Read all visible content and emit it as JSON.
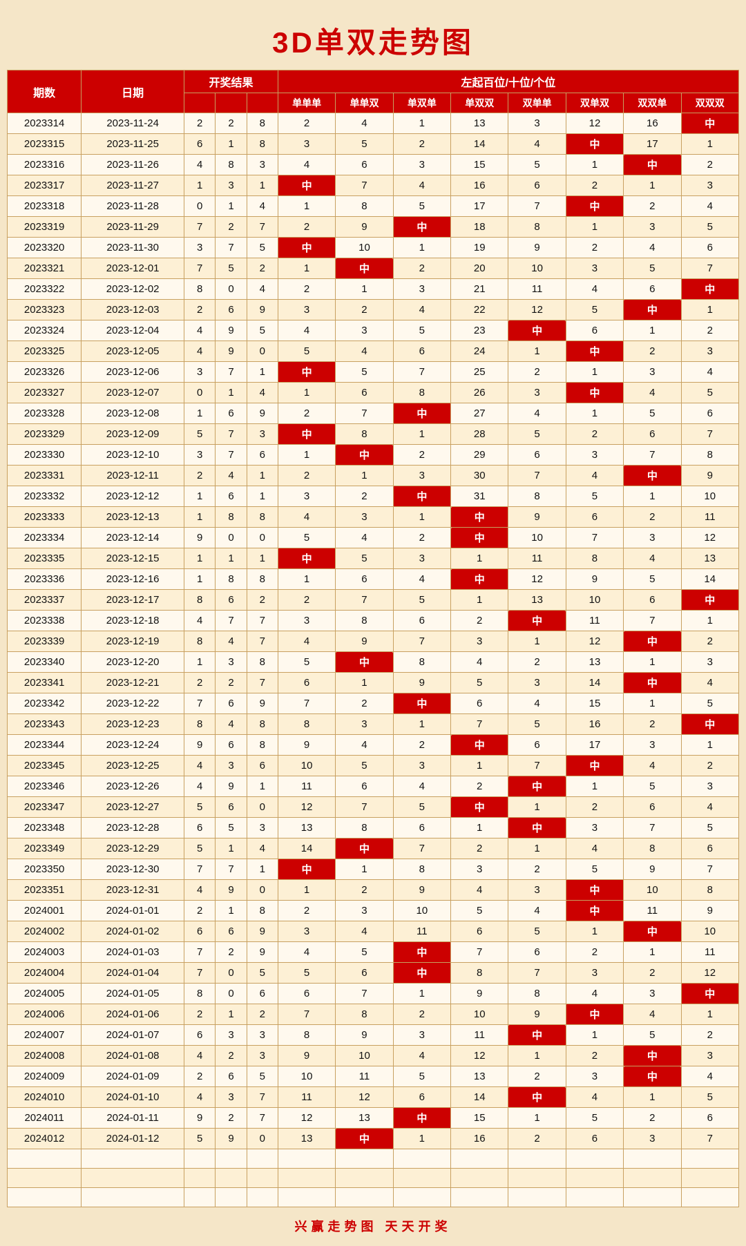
{
  "title": "3D单双走势图",
  "subtitle": "左起百位/十位/个位",
  "headers": {
    "qishu": "期数",
    "riqi": "日期",
    "kaijang": "开奖结果",
    "cols": [
      "单单单",
      "单单双",
      "单双单",
      "单双双",
      "双单单",
      "双单双",
      "双双单",
      "双双双"
    ]
  },
  "footer": "兴赢走势图   天天开奖",
  "rows": [
    {
      "id": "2023314",
      "date": "2023-11-24",
      "k1": "2",
      "k2": "2",
      "k3": "8",
      "d": [
        2,
        4,
        1,
        13,
        3,
        12,
        16,
        "中"
      ]
    },
    {
      "id": "2023315",
      "date": "2023-11-25",
      "k1": "6",
      "k2": "1",
      "k3": "8",
      "d": [
        3,
        5,
        2,
        14,
        4,
        "中",
        17,
        1
      ]
    },
    {
      "id": "2023316",
      "date": "2023-11-26",
      "k1": "4",
      "k2": "8",
      "k3": "3",
      "d": [
        4,
        6,
        3,
        15,
        5,
        1,
        "中",
        2
      ]
    },
    {
      "id": "2023317",
      "date": "2023-11-27",
      "k1": "1",
      "k2": "3",
      "k3": "1",
      "d": [
        "中",
        7,
        4,
        16,
        6,
        2,
        1,
        3
      ]
    },
    {
      "id": "2023318",
      "date": "2023-11-28",
      "k1": "0",
      "k2": "1",
      "k3": "4",
      "d": [
        1,
        8,
        5,
        17,
        7,
        "中",
        2,
        4
      ]
    },
    {
      "id": "2023319",
      "date": "2023-11-29",
      "k1": "7",
      "k2": "2",
      "k3": "7",
      "d": [
        2,
        9,
        "中",
        18,
        8,
        1,
        3,
        5
      ]
    },
    {
      "id": "2023320",
      "date": "2023-11-30",
      "k1": "3",
      "k2": "7",
      "k3": "5",
      "d": [
        "中",
        10,
        1,
        19,
        9,
        2,
        4,
        6
      ]
    },
    {
      "id": "2023321",
      "date": "2023-12-01",
      "k1": "7",
      "k2": "5",
      "k3": "2",
      "d": [
        1,
        "中",
        2,
        20,
        10,
        3,
        5,
        7
      ]
    },
    {
      "id": "2023322",
      "date": "2023-12-02",
      "k1": "8",
      "k2": "0",
      "k3": "4",
      "d": [
        2,
        1,
        3,
        21,
        11,
        4,
        6,
        "中"
      ]
    },
    {
      "id": "2023323",
      "date": "2023-12-03",
      "k1": "2",
      "k2": "6",
      "k3": "9",
      "d": [
        3,
        2,
        4,
        22,
        12,
        5,
        "中",
        1
      ]
    },
    {
      "id": "2023324",
      "date": "2023-12-04",
      "k1": "4",
      "k2": "9",
      "k3": "5",
      "d": [
        4,
        3,
        5,
        23,
        "中",
        6,
        1,
        2
      ]
    },
    {
      "id": "2023325",
      "date": "2023-12-05",
      "k1": "4",
      "k2": "9",
      "k3": "0",
      "d": [
        5,
        4,
        6,
        24,
        1,
        "中",
        2,
        3
      ]
    },
    {
      "id": "2023326",
      "date": "2023-12-06",
      "k1": "3",
      "k2": "7",
      "k3": "1",
      "d": [
        "中",
        5,
        7,
        25,
        2,
        1,
        3,
        4
      ]
    },
    {
      "id": "2023327",
      "date": "2023-12-07",
      "k1": "0",
      "k2": "1",
      "k3": "4",
      "d": [
        1,
        6,
        8,
        26,
        3,
        "中",
        4,
        5
      ]
    },
    {
      "id": "2023328",
      "date": "2023-12-08",
      "k1": "1",
      "k2": "6",
      "k3": "9",
      "d": [
        2,
        7,
        "中",
        27,
        4,
        1,
        5,
        6
      ]
    },
    {
      "id": "2023329",
      "date": "2023-12-09",
      "k1": "5",
      "k2": "7",
      "k3": "3",
      "d": [
        "中",
        8,
        1,
        28,
        5,
        2,
        6,
        7
      ]
    },
    {
      "id": "2023330",
      "date": "2023-12-10",
      "k1": "3",
      "k2": "7",
      "k3": "6",
      "d": [
        1,
        "中",
        2,
        29,
        6,
        3,
        7,
        8
      ]
    },
    {
      "id": "2023331",
      "date": "2023-12-11",
      "k1": "2",
      "k2": "4",
      "k3": "1",
      "d": [
        2,
        1,
        3,
        30,
        7,
        4,
        "中",
        9
      ]
    },
    {
      "id": "2023332",
      "date": "2023-12-12",
      "k1": "1",
      "k2": "6",
      "k3": "1",
      "d": [
        3,
        2,
        "中",
        31,
        8,
        5,
        1,
        10
      ]
    },
    {
      "id": "2023333",
      "date": "2023-12-13",
      "k1": "1",
      "k2": "8",
      "k3": "8",
      "d": [
        4,
        3,
        1,
        "中",
        9,
        6,
        2,
        11
      ]
    },
    {
      "id": "2023334",
      "date": "2023-12-14",
      "k1": "9",
      "k2": "0",
      "k3": "0",
      "d": [
        5,
        4,
        2,
        "中",
        10,
        7,
        3,
        12
      ]
    },
    {
      "id": "2023335",
      "date": "2023-12-15",
      "k1": "1",
      "k2": "1",
      "k3": "1",
      "d": [
        "中",
        5,
        3,
        1,
        11,
        8,
        4,
        13
      ]
    },
    {
      "id": "2023336",
      "date": "2023-12-16",
      "k1": "1",
      "k2": "8",
      "k3": "8",
      "d": [
        1,
        6,
        4,
        "中",
        12,
        9,
        5,
        14
      ]
    },
    {
      "id": "2023337",
      "date": "2023-12-17",
      "k1": "8",
      "k2": "6",
      "k3": "2",
      "d": [
        2,
        7,
        5,
        1,
        13,
        10,
        6,
        "中"
      ]
    },
    {
      "id": "2023338",
      "date": "2023-12-18",
      "k1": "4",
      "k2": "7",
      "k3": "7",
      "d": [
        3,
        8,
        6,
        2,
        "中",
        11,
        7,
        1
      ]
    },
    {
      "id": "2023339",
      "date": "2023-12-19",
      "k1": "8",
      "k2": "4",
      "k3": "7",
      "d": [
        4,
        9,
        7,
        3,
        1,
        12,
        "中",
        2
      ]
    },
    {
      "id": "2023340",
      "date": "2023-12-20",
      "k1": "1",
      "k2": "3",
      "k3": "8",
      "d": [
        5,
        "中",
        8,
        4,
        2,
        13,
        1,
        3
      ]
    },
    {
      "id": "2023341",
      "date": "2023-12-21",
      "k1": "2",
      "k2": "2",
      "k3": "7",
      "d": [
        6,
        1,
        9,
        5,
        3,
        14,
        "中",
        4
      ]
    },
    {
      "id": "2023342",
      "date": "2023-12-22",
      "k1": "7",
      "k2": "6",
      "k3": "9",
      "d": [
        7,
        2,
        "中",
        6,
        4,
        15,
        1,
        5
      ]
    },
    {
      "id": "2023343",
      "date": "2023-12-23",
      "k1": "8",
      "k2": "4",
      "k3": "8",
      "d": [
        8,
        3,
        1,
        7,
        5,
        16,
        2,
        "中"
      ]
    },
    {
      "id": "2023344",
      "date": "2023-12-24",
      "k1": "9",
      "k2": "6",
      "k3": "8",
      "d": [
        9,
        4,
        2,
        "中",
        6,
        17,
        3,
        1
      ]
    },
    {
      "id": "2023345",
      "date": "2023-12-25",
      "k1": "4",
      "k2": "3",
      "k3": "6",
      "d": [
        10,
        5,
        3,
        1,
        7,
        "中",
        4,
        2
      ]
    },
    {
      "id": "2023346",
      "date": "2023-12-26",
      "k1": "4",
      "k2": "9",
      "k3": "1",
      "d": [
        11,
        6,
        4,
        2,
        "中",
        1,
        5,
        3
      ]
    },
    {
      "id": "2023347",
      "date": "2023-12-27",
      "k1": "5",
      "k2": "6",
      "k3": "0",
      "d": [
        12,
        7,
        5,
        "中",
        1,
        2,
        6,
        4
      ]
    },
    {
      "id": "2023348",
      "date": "2023-12-28",
      "k1": "6",
      "k2": "5",
      "k3": "3",
      "d": [
        13,
        8,
        6,
        1,
        "中",
        3,
        7,
        5
      ]
    },
    {
      "id": "2023349",
      "date": "2023-12-29",
      "k1": "5",
      "k2": "1",
      "k3": "4",
      "d": [
        14,
        "中",
        7,
        2,
        1,
        4,
        8,
        6
      ]
    },
    {
      "id": "2023350",
      "date": "2023-12-30",
      "k1": "7",
      "k2": "7",
      "k3": "1",
      "d": [
        "中",
        1,
        8,
        3,
        2,
        5,
        9,
        7
      ]
    },
    {
      "id": "2023351",
      "date": "2023-12-31",
      "k1": "4",
      "k2": "9",
      "k3": "0",
      "d": [
        1,
        2,
        9,
        4,
        3,
        "中",
        10,
        8
      ]
    },
    {
      "id": "2024001",
      "date": "2024-01-01",
      "k1": "2",
      "k2": "1",
      "k3": "8",
      "d": [
        2,
        3,
        10,
        5,
        4,
        "中",
        11,
        9
      ]
    },
    {
      "id": "2024002",
      "date": "2024-01-02",
      "k1": "6",
      "k2": "6",
      "k3": "9",
      "d": [
        3,
        4,
        11,
        6,
        5,
        1,
        "中",
        10
      ]
    },
    {
      "id": "2024003",
      "date": "2024-01-03",
      "k1": "7",
      "k2": "2",
      "k3": "9",
      "d": [
        4,
        5,
        "中",
        7,
        6,
        2,
        1,
        11
      ]
    },
    {
      "id": "2024004",
      "date": "2024-01-04",
      "k1": "7",
      "k2": "0",
      "k3": "5",
      "d": [
        5,
        6,
        "中",
        8,
        7,
        3,
        2,
        12
      ]
    },
    {
      "id": "2024005",
      "date": "2024-01-05",
      "k1": "8",
      "k2": "0",
      "k3": "6",
      "d": [
        6,
        7,
        1,
        9,
        8,
        4,
        3,
        "中"
      ]
    },
    {
      "id": "2024006",
      "date": "2024-01-06",
      "k1": "2",
      "k2": "1",
      "k3": "2",
      "d": [
        7,
        8,
        2,
        10,
        9,
        "中",
        4,
        1
      ]
    },
    {
      "id": "2024007",
      "date": "2024-01-07",
      "k1": "6",
      "k2": "3",
      "k3": "3",
      "d": [
        8,
        9,
        3,
        11,
        "中",
        1,
        5,
        2
      ]
    },
    {
      "id": "2024008",
      "date": "2024-01-08",
      "k1": "4",
      "k2": "2",
      "k3": "3",
      "d": [
        9,
        10,
        4,
        12,
        1,
        2,
        "中",
        3
      ]
    },
    {
      "id": "2024009",
      "date": "2024-01-09",
      "k1": "2",
      "k2": "6",
      "k3": "5",
      "d": [
        10,
        11,
        5,
        13,
        2,
        3,
        "中",
        4
      ]
    },
    {
      "id": "2024010",
      "date": "2024-01-10",
      "k1": "4",
      "k2": "3",
      "k3": "7",
      "d": [
        11,
        12,
        6,
        14,
        "中",
        4,
        1,
        5
      ]
    },
    {
      "id": "2024011",
      "date": "2024-01-11",
      "k1": "9",
      "k2": "2",
      "k3": "7",
      "d": [
        12,
        13,
        "中",
        15,
        1,
        5,
        2,
        6
      ]
    },
    {
      "id": "2024012",
      "date": "2024-01-12",
      "k1": "5",
      "k2": "9",
      "k3": "0",
      "d": [
        13,
        "中",
        1,
        16,
        2,
        6,
        3,
        7
      ]
    }
  ]
}
